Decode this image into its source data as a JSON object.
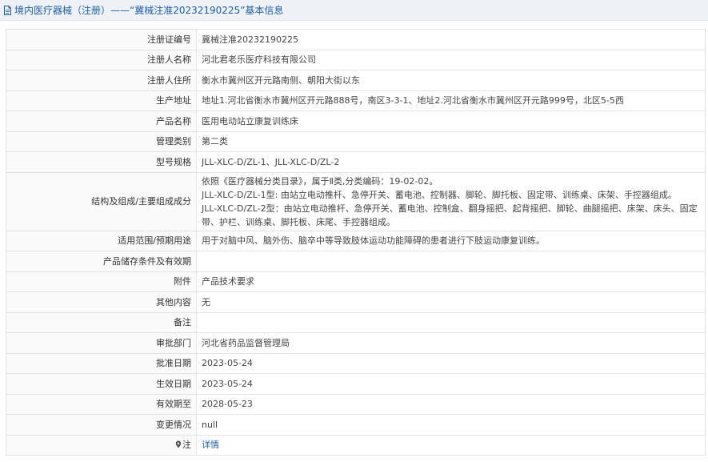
{
  "header": {
    "title": "境内医疗器械（注册）——“冀械注准20232190225”基本信息"
  },
  "rows": [
    {
      "label": "注册证编号",
      "value": "冀械注准20232190225"
    },
    {
      "label": "注册人名称",
      "value": "河北君老乐医疗科技有限公司"
    },
    {
      "label": "注册人住所",
      "value": "衡水市冀州区开元路南侧、朝阳大街以东"
    },
    {
      "label": "生产地址",
      "value": "地址1.河北省衡水市冀州区开元路888号，南区3-3-1、地址2.河北省衡水市冀州区开元路999号，北区5-5西"
    },
    {
      "label": "产品名称",
      "value": "医用电动站立康复训练床"
    },
    {
      "label": "管理类别",
      "value": "第二类"
    },
    {
      "label": "型号规格",
      "value": "JLL-XLC-D/ZL-1、JLL-XLC-D/ZL-2"
    },
    {
      "label": "结构及组成/主要组成成分",
      "lines": [
        "依照《医疗器械分类目录》，属于Ⅱ类,分类编码：19-02-02。",
        "JLL-XLC-D/ZL-1型: 由站立电动推杆、急停开关、蓄电池、控制器、脚轮、脚托板、固定带、训练桌、床架、手控器组成。",
        "JLL-XLC-D/ZL-2型：由站立电动推杆、急停开关、蓄电池、控制盒、翻身摇把、起背摇把、脚轮、曲腿摇把、床架、床头、固定带、护栏、训练桌、脚托板、床尾、手控器组成。"
      ]
    },
    {
      "label": "适用范围/预期用途",
      "value": "用于对脑中风、脑外伤、脑卒中等导致肢体运动功能障碍的患者进行下肢运动康复训练。"
    },
    {
      "label": "产品储存条件及有效期",
      "value": ""
    },
    {
      "label": "附件",
      "value": "产品技术要求"
    },
    {
      "label": "其他内容",
      "value": "无"
    },
    {
      "label": "备注",
      "value": ""
    },
    {
      "label": "审批部门",
      "value": "河北省药品监督管理局"
    },
    {
      "label": "批准日期",
      "value": "2023-05-24"
    },
    {
      "label": "生效日期",
      "value": "2023-05-24"
    },
    {
      "label": "有效期至",
      "value": "2028-05-23"
    },
    {
      "label": "变更情况",
      "value": "null"
    }
  ],
  "note": {
    "label": "注",
    "link_text": "详情"
  },
  "colors": {
    "accent": "#1e5fa8",
    "header_bg": "#eef1f5",
    "border": "#e2e2e2"
  }
}
